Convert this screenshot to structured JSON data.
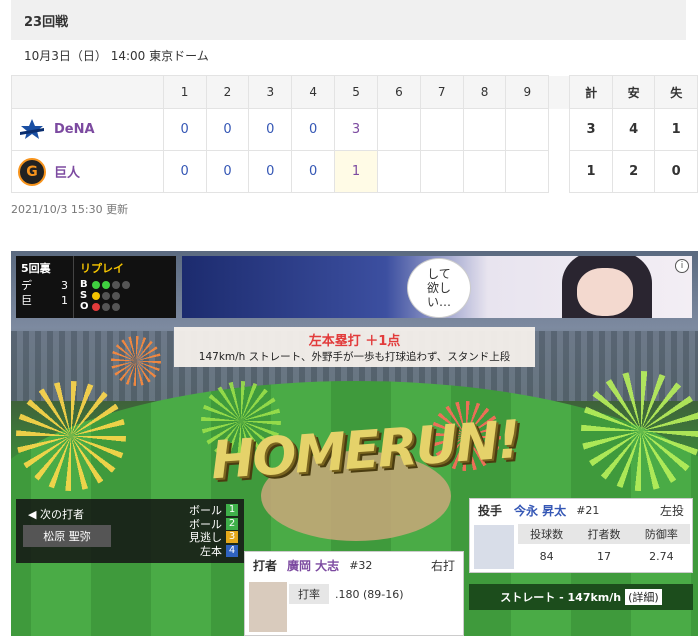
{
  "header": {
    "title": "23回戦",
    "meta": "10月3日（日） 14:00 東京ドーム"
  },
  "scoreboard": {
    "innings": [
      "1",
      "2",
      "3",
      "4",
      "5",
      "6",
      "7",
      "8",
      "9"
    ],
    "totals_headers": [
      "計",
      "安",
      "失"
    ],
    "teams": [
      {
        "name": "DeNA",
        "scores": [
          "0",
          "0",
          "0",
          "0",
          "3",
          "",
          "",
          "",
          ""
        ],
        "totals": [
          "3",
          "4",
          "1"
        ]
      },
      {
        "name": "巨人",
        "scores": [
          "0",
          "0",
          "0",
          "0",
          "1",
          "",
          "",
          "",
          ""
        ],
        "totals": [
          "1",
          "2",
          "0"
        ]
      }
    ],
    "updated": "2021/10/3 15:30 更新"
  },
  "live": {
    "count": {
      "inning": "5回裏",
      "away_short": "デ",
      "away_score": "3",
      "home_short": "巨",
      "home_score": "1",
      "replay": "リプレイ",
      "b_label": "B",
      "s_label": "S",
      "o_label": "O"
    },
    "ad": {
      "line1": "して",
      "line2": "欲し",
      "line3": "い…"
    },
    "play": {
      "title": "左本塁打 ＋1点",
      "desc": "147km/h ストレート、外野手が一歩も打球追わず、スタンド上段"
    },
    "banner": "HOMERUN!",
    "next_batter": {
      "label": "◀ 次の打者",
      "name": "松原 聖弥",
      "pitches": [
        {
          "text": "ボール",
          "n": "1"
        },
        {
          "text": "ボール",
          "n": "2"
        },
        {
          "text": "見逃し",
          "n": "3"
        },
        {
          "text": "左本",
          "n": "4"
        }
      ]
    },
    "pitcher": {
      "tag": "投手",
      "name": "今永 昇太",
      "number": "#21",
      "hand": "左投",
      "headers": [
        "投球数",
        "打者数",
        "防御率"
      ],
      "values": [
        "84",
        "17",
        "2.74"
      ]
    },
    "pitch_info": {
      "text": "ストレート - 147km/h",
      "detail": "(詳細)"
    },
    "batter": {
      "tag": "打者",
      "name": "廣岡 大志",
      "number": "#32",
      "hand": "右打",
      "stat_label": "打率",
      "stat_value": ".180 (89-16)"
    }
  }
}
